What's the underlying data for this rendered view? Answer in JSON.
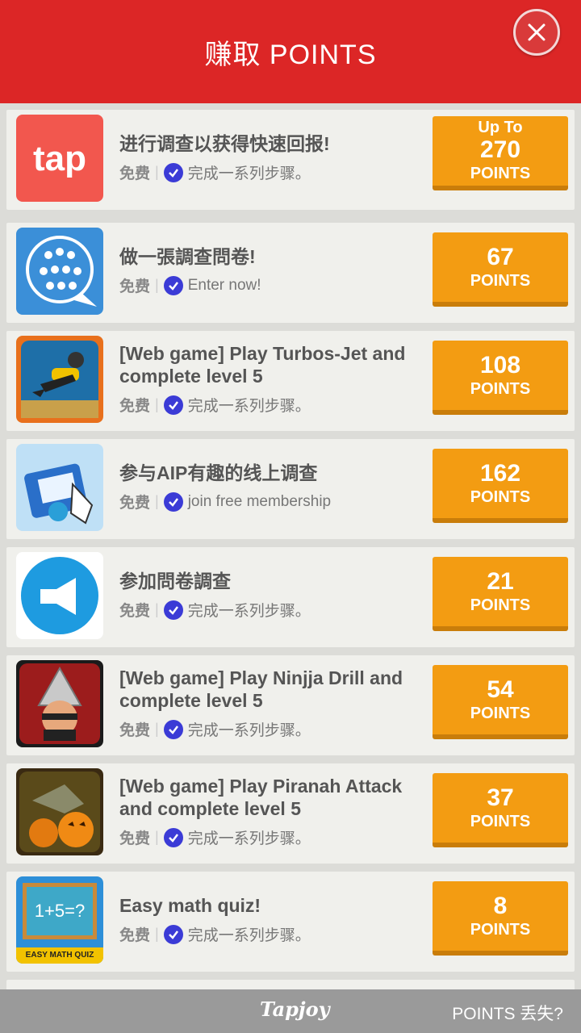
{
  "header": {
    "title": "赚取 POINTS"
  },
  "offers": [
    {
      "title": "进行调查以获得快速回报!",
      "free": "免费",
      "desc": "完成一系列步骤。",
      "upto": "Up To",
      "points": "270",
      "label": "POINTS",
      "icon": "tap-icon"
    },
    {
      "title": "做一張調查問卷!",
      "free": "免费",
      "desc": "Enter now!",
      "upto": "",
      "points": "67",
      "label": "POINTS",
      "icon": "survey-people-icon"
    },
    {
      "title": "[Web game] Play Turbos-Jet and complete level 5",
      "free": "免费",
      "desc": "完成一系列步骤。",
      "upto": "",
      "points": "108",
      "label": "POINTS",
      "icon": "diver-game-icon"
    },
    {
      "title": "参与AIP有趣的线上调查",
      "free": "免费",
      "desc": "join free membership",
      "upto": "",
      "points": "162",
      "label": "POINTS",
      "icon": "gift-money-icon"
    },
    {
      "title": "参加問卷調查",
      "free": "免费",
      "desc": "完成一系列步骤。",
      "upto": "",
      "points": "21",
      "label": "POINTS",
      "icon": "megaphone-icon"
    },
    {
      "title": "[Web game] Play Ninjja Drill and complete level 5",
      "free": "免费",
      "desc": "完成一系列步骤。",
      "upto": "",
      "points": "54",
      "label": "POINTS",
      "icon": "ninja-drill-icon"
    },
    {
      "title": "[Web game] Play Piranah Attack and complete level 5",
      "free": "免费",
      "desc": "完成一系列步骤。",
      "upto": "",
      "points": "37",
      "label": "POINTS",
      "icon": "piranha-pumpkin-icon"
    },
    {
      "title": "Easy math quiz!",
      "free": "免费",
      "desc": "完成一系列步骤。",
      "upto": "",
      "points": "8",
      "label": "POINTS",
      "icon": "math-quiz-icon"
    }
  ],
  "thumbs": {
    "tap_text": "tap",
    "math_board": "1+5=?",
    "math_banner": "EASY MATH QUIZ"
  },
  "footer": {
    "brand": "Tapjoy",
    "lost_points": "POINTS 丢失?"
  },
  "colors": {
    "header": "#dc2626",
    "button": "#f39c12",
    "check": "#3b3bd6"
  }
}
